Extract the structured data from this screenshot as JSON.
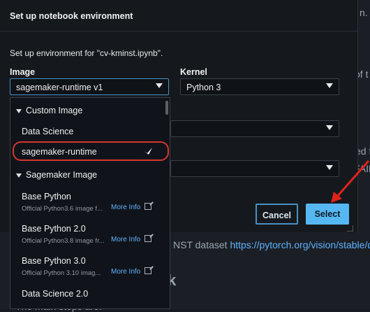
{
  "modal": {
    "title": "Set up notebook environment",
    "subtitle": "Set up environment for \"cv-kminst.ipynb\".",
    "image_label": "Image",
    "image_value": "sagemaker-runtime v1",
    "kernel_label": "Kernel",
    "kernel_value": "Python 3",
    "cancel_label": "Cancel",
    "select_label": "Select"
  },
  "dropdown": {
    "custom_group": "Custom Image",
    "custom_items": [
      "Data Science",
      "sagemaker-runtime"
    ],
    "sagemaker_group": "Sagemaker Image",
    "sagemaker_items": [
      {
        "name": "Base Python",
        "desc": "Official Python3.6 image f...",
        "more": "More Info"
      },
      {
        "name": "Base Python 2.0",
        "desc": "Official Python3.8 image fr...",
        "more": "More Info"
      },
      {
        "name": "Base Python 3.0",
        "desc": "Official Python 3.10 imag...",
        "more": "More Info"
      },
      {
        "name": "Data Science 2.0",
        "desc": "",
        "more": ""
      }
    ]
  },
  "background": {
    "text_1": "n.",
    "text_2": "of t",
    "text_3": "ed f",
    "text_4": "FAIR",
    "text_5": "NST dataset",
    "link": "https://pytorch.org/vision/stable/d",
    "heading": "k",
    "steps": "The main steps are:"
  },
  "colors": {
    "accent": "#56b8f2",
    "highlight_ring": "#d6362f",
    "arrow": "#e0231c"
  }
}
